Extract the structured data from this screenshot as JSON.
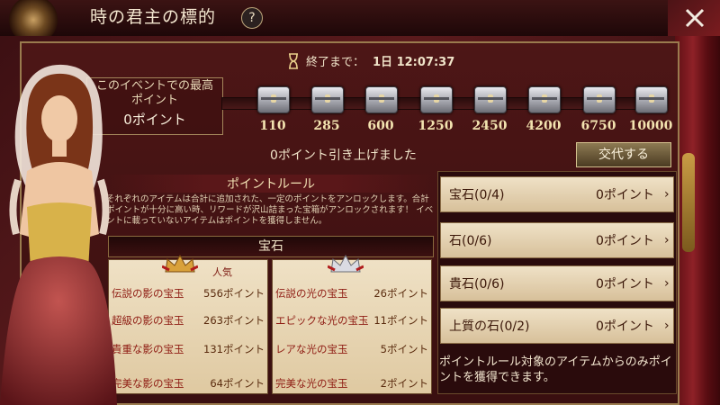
{
  "header": {
    "title": "時の君主の標的",
    "help_icon": "question-icon",
    "close_icon": "close-icon"
  },
  "timer": {
    "label": "終了まで：",
    "value": "1日 12:07:37"
  },
  "best": {
    "label": "このイベントでの最高ポイント",
    "value": "0ポイント"
  },
  "milestones": [
    "110",
    "285",
    "600",
    "1250",
    "2450",
    "4200",
    "6750",
    "10000"
  ],
  "raised_text": "0ポイント引き上げました",
  "exchange_label": "交代する",
  "rules": {
    "title": "ポイントルール",
    "description": "それぞれのアイテムは合計に追加された、一定のポイントをアンロックします。合計ポイントが十分に高い時、リワードが沢山詰まった宝箱がアンロックされます！ イベントに載っていないアイテムはポイントを獲得しません。"
  },
  "gem_section": {
    "header": "宝石",
    "popular_badge": "人気",
    "left_rows": [
      {
        "name": "伝説の影の宝玉",
        "points": "556ポイント"
      },
      {
        "name": "超級の影の宝玉",
        "points": "263ポイント"
      },
      {
        "name": "貴重な影の宝玉",
        "points": "131ポイント"
      },
      {
        "name": "完美な影の宝玉",
        "points": "64ポイント"
      }
    ],
    "right_rows": [
      {
        "name": "伝説の光の宝玉",
        "points": "26ポイント"
      },
      {
        "name": "エピックな光の宝玉",
        "points": "11ポイント"
      },
      {
        "name": "レアな光の宝玉",
        "points": "5ポイント"
      },
      {
        "name": "完美な光の宝玉",
        "points": "2ポイント"
      }
    ]
  },
  "categories": [
    {
      "name": "宝石(0/4)",
      "points": "0ポイント"
    },
    {
      "name": "石(0/6)",
      "points": "0ポイント"
    },
    {
      "name": "貴石(0/6)",
      "points": "0ポイント"
    },
    {
      "name": "上質の石(0/2)",
      "points": "0ポイント"
    }
  ],
  "category_note": "ポイントルール対象のアイテムからのみポイントを獲得できます。",
  "colors": {
    "accent_gold": "#c9a063",
    "panel_cream": "#efe1c5",
    "frame_red": "#4d1616"
  }
}
